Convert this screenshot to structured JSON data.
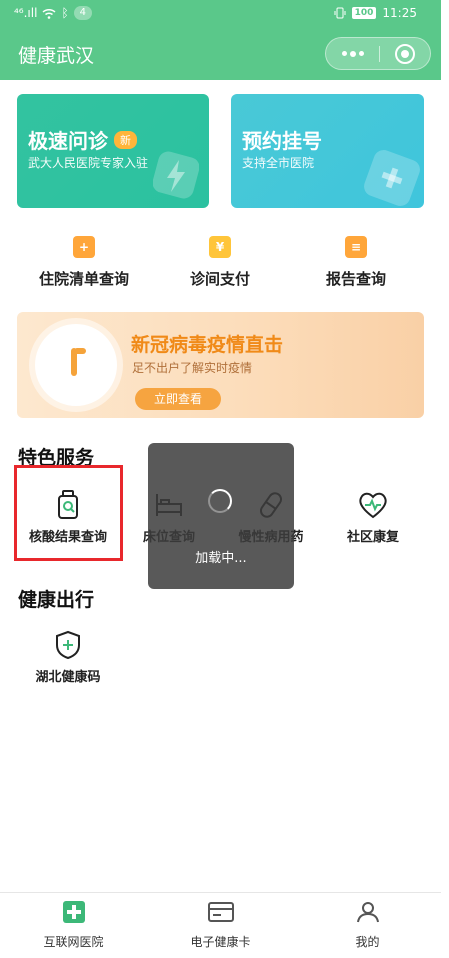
{
  "status_bar": {
    "signal": "⁴⁶.ıll",
    "notification_count": "4",
    "battery": "100",
    "time": "11:25"
  },
  "nav": {
    "title": "健康武汉"
  },
  "cards": [
    {
      "title": "极速问诊",
      "badge": "新",
      "subtitle": "武大人民医院专家入驻"
    },
    {
      "title": "预约挂号",
      "subtitle": "支持全市医院"
    }
  ],
  "quick_links": [
    {
      "label": "住院清单查询",
      "icon": "+"
    },
    {
      "label": "诊间支付",
      "icon": "¥"
    },
    {
      "label": "报告查询",
      "icon": "≡"
    }
  ],
  "banner": {
    "title": "新冠病毒疫情直击",
    "subtitle": "足不出户了解实时疫情",
    "button": "立即查看"
  },
  "special_services": {
    "title": "特色服务",
    "items": [
      {
        "label": "核酸结果查询",
        "icon": "test-bottle-icon"
      },
      {
        "label": "床位查询",
        "icon": "bed-icon"
      },
      {
        "label": "慢性病用药",
        "icon": "pill-icon"
      },
      {
        "label": "社区康复",
        "icon": "heart-icon"
      }
    ]
  },
  "health_travel": {
    "title": "健康出行",
    "items": [
      {
        "label": "湖北健康码",
        "icon": "shield-plus-icon"
      }
    ]
  },
  "loading": {
    "text": "加载中..."
  },
  "tabbar": {
    "items": [
      {
        "label": "互联网医院",
        "icon": "hospital-plus-icon"
      },
      {
        "label": "电子健康卡",
        "icon": "card-icon"
      },
      {
        "label": "我的",
        "icon": "user-icon"
      }
    ]
  },
  "colors": {
    "primary_green": "#5ac88a",
    "card_teal": "#2bc1a0",
    "card_cyan": "#49c9d6",
    "orange": "#f6a440",
    "highlight_red": "#e8282c"
  }
}
